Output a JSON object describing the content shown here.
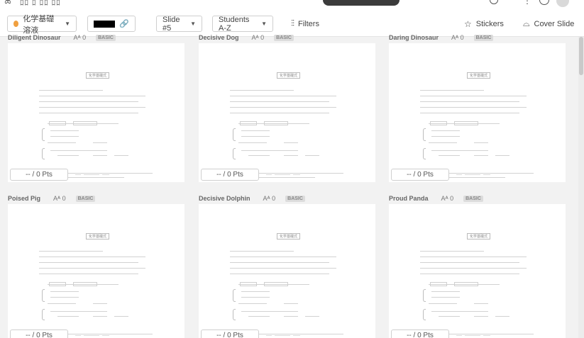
{
  "header": {
    "title_fragment": "ﾛﾛ ﾛ ﾛﾛ  ﾛﾛ",
    "logo_icon": "pear-icon"
  },
  "toolbar": {
    "class_name": "化学基礎溶液",
    "class_dot_color": "#f0a040",
    "slide_label": "Slide #5",
    "sort_label": "Students A-Z",
    "filters_label": "Filters",
    "stickers_label": "Stickers",
    "cover_label": "Cover Slide"
  },
  "worksheet": {
    "title": "化学基礎式"
  },
  "students": [
    {
      "name": "Diligent Dinosaur",
      "aa": "0",
      "badge": "BASIC",
      "points": "-- / 0 Pts"
    },
    {
      "name": "Decisive Dog",
      "aa": "0",
      "badge": "BASIC",
      "points": "-- / 0 Pts"
    },
    {
      "name": "Daring Dinosaur",
      "aa": "0",
      "badge": "BASIC",
      "points": "-- / 0 Pts"
    },
    {
      "name": "Poised Pig",
      "aa": "0",
      "badge": "BASIC",
      "points": "-- / 0 Pts"
    },
    {
      "name": "Decisive Dolphin",
      "aa": "0",
      "badge": "BASIC",
      "points": "-- / 0 Pts"
    },
    {
      "name": "Proud Panda",
      "aa": "0",
      "badge": "BASIC",
      "points": "-- / 0 Pts"
    }
  ]
}
